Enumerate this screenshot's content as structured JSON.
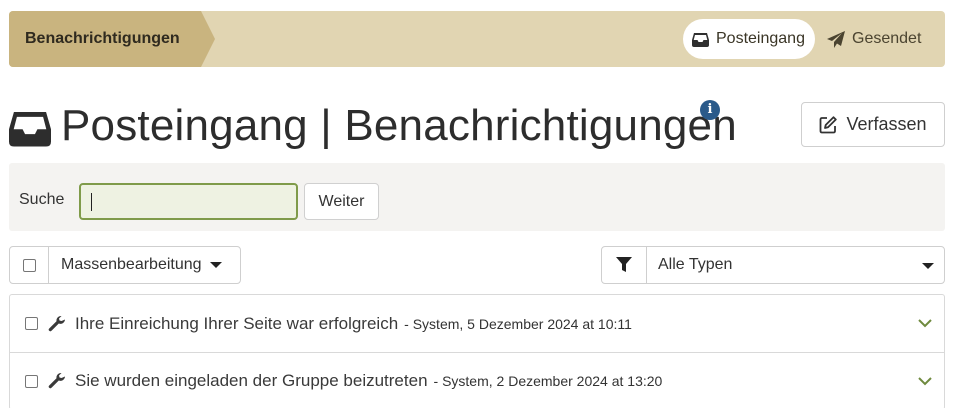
{
  "topbar": {
    "breadcrumb": "Benachrichtigungen",
    "tabs": [
      {
        "label": "Posteingang",
        "icon": "inbox-icon",
        "active": true
      },
      {
        "label": "Gesendet",
        "icon": "paper-plane-icon",
        "active": false
      }
    ]
  },
  "header": {
    "title": "Posteingang | Benachrichtigungen",
    "title_icon": "inbox-icon",
    "info_glyph": "i",
    "compose_label": "Verfassen"
  },
  "search": {
    "label": "Suche",
    "value": "",
    "button_label": "Weiter"
  },
  "toolbar": {
    "bulk_label": "Massenbearbeitung",
    "filter_value": "Alle Typen"
  },
  "messages": [
    {
      "subject": "Ihre Einreichung Ihrer Seite war erfolgreich",
      "meta": "- System, 5 Dezember 2024 at 10:11"
    },
    {
      "subject": "Sie wurden eingeladen der Gruppe beizutreten",
      "meta": "- System, 2 Dezember 2024 at 13:20"
    }
  ],
  "colors": {
    "topbar_bg": "#e1d5b2",
    "breadcrumb_bg": "#c9b47f",
    "accent_green": "#7f9b4a",
    "info_blue": "#2a5a8a"
  }
}
